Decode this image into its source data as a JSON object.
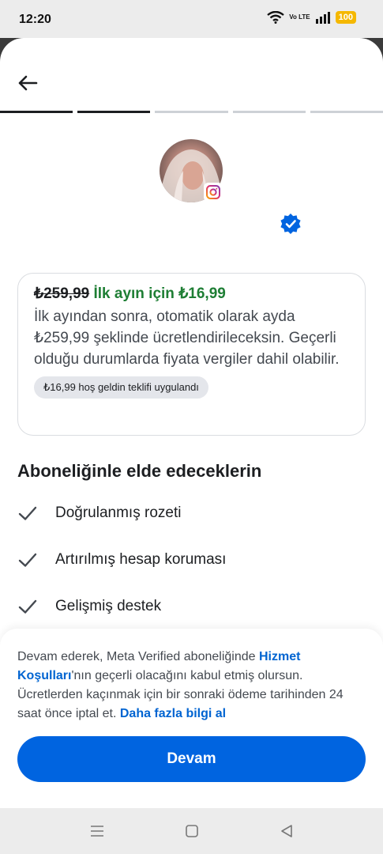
{
  "status_bar": {
    "time": "12:20",
    "network": "Vo LTE",
    "battery": "100"
  },
  "header": {
    "back_icon": "arrow-left-icon",
    "steps_total": 5,
    "steps_completed": 2
  },
  "profile": {
    "avatar_icon": "profile-avatar",
    "badge_icon": "instagram-icon",
    "verified_icon": "verified-badge-icon"
  },
  "offer": {
    "old_price": "₺259,99",
    "promo_text": "İlk ayın için ₺16,99",
    "description": "İlk ayından sonra, otomatik olarak ayda ₺259,99 şeklinde ücretlendirileceksin. Geçerli olduğu durumlarda fiyata vergiler dahil olabilir.",
    "chip": "₺16,99 hoş geldin teklifi uygulandı"
  },
  "benefits": {
    "title": "Aboneliğinle elde edeceklerin",
    "items": [
      {
        "label": "Doğrulanmış rozeti"
      },
      {
        "label": "Artırılmış hesap koruması"
      },
      {
        "label": "Gelişmiş destek"
      }
    ]
  },
  "footer": {
    "terms_pre": "Devam ederek, Meta Verified aboneliğinde ",
    "terms_link": "Hizmet Koşulları",
    "terms_mid": "'nın geçerli olacağını kabul etmiş olursun. Ücretlerden kaçınmak için bir sonraki ödeme tarihinden 24 saat önce iptal et. ",
    "more_link": "Daha fazla bilgi al",
    "continue_label": "Devam"
  },
  "colors": {
    "primary": "#0064e0",
    "promo_green": "#1e7e34",
    "link": "#0064d1",
    "verified": "#0064e0"
  }
}
